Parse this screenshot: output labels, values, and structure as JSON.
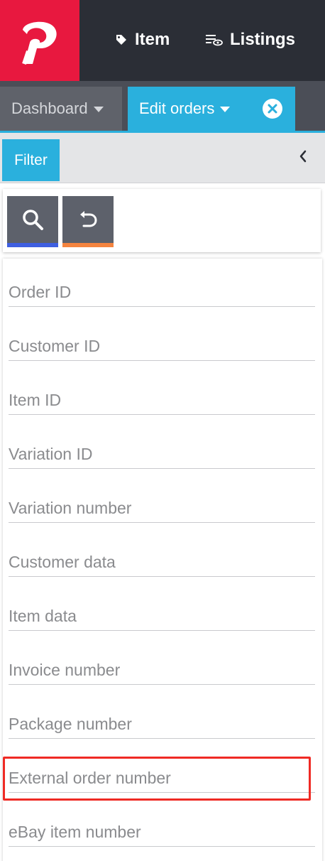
{
  "colors": {
    "brand": "#e8183f",
    "topbar": "#2b2e36",
    "accent": "#2ab0dd",
    "search_underline": "#3f5fe0",
    "reset_underline": "#f4843f",
    "highlight": "#ef2a24"
  },
  "topnav": {
    "logo_icon": "plenty-logo-icon",
    "items": [
      {
        "label": "Item",
        "icon": "tag-icon"
      },
      {
        "label": "Listings",
        "icon": "listings-icon"
      }
    ]
  },
  "tabs": [
    {
      "label": "Dashboard",
      "active": false
    },
    {
      "label": "Edit orders",
      "active": true
    }
  ],
  "filter": {
    "label": "Filter",
    "collapse_icon": "chevron-left-icon"
  },
  "actions": {
    "search_icon": "search-icon",
    "reset_icon": "undo-icon"
  },
  "fields": [
    "Order ID",
    "Customer ID",
    "Item ID",
    "Variation ID",
    "Variation number",
    "Customer data",
    "Item data",
    "Invoice number",
    "Package number",
    "External order number",
    "eBay item number"
  ],
  "highlighted_field": "External order number"
}
